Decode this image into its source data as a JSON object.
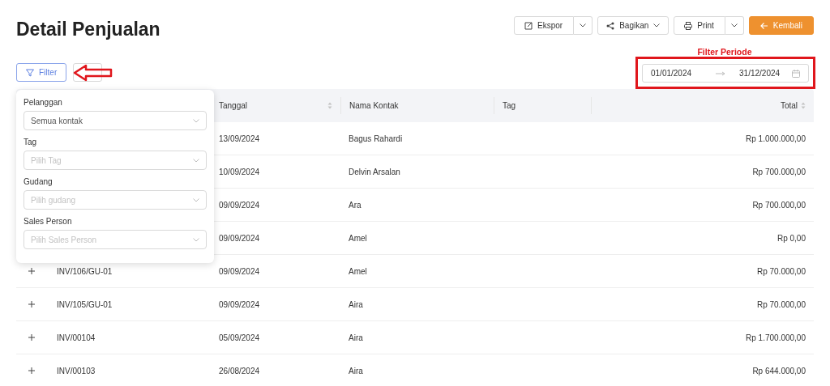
{
  "title": "Detail Penjualan",
  "toolbar": [
    {
      "kind": "split",
      "label": "Ekspor"
    },
    {
      "kind": "menu",
      "label": "Bagikan"
    },
    {
      "kind": "split",
      "label": "Print"
    },
    {
      "kind": "primary",
      "label": "Kembali"
    }
  ],
  "filter_button": {
    "label": "Filter"
  },
  "annotations": {
    "period_label": "Filter Periode"
  },
  "date_range": {
    "start": "01/01/2024",
    "end": "31/12/2024"
  },
  "filter_panel": [
    {
      "label": "Pelanggan",
      "value": "Semua kontak"
    },
    {
      "label": "Tag",
      "placeholder": "Pilih Tag"
    },
    {
      "label": "Gudang",
      "placeholder": "Pilih gudang"
    },
    {
      "label": "Sales Person",
      "placeholder": "Pilih Sales Person"
    }
  ],
  "table": {
    "columns": [
      {
        "label": "Tanggal",
        "sortable": true
      },
      {
        "label": "Nama Kontak",
        "sortable": false
      },
      {
        "label": "Tag",
        "sortable": false
      },
      {
        "label": "Total",
        "sortable": true
      }
    ],
    "rows": [
      {
        "tanggal": "13/09/2024",
        "kontak": "Bagus Rahardi",
        "total": "Rp 1.000.000,00"
      },
      {
        "tanggal": "10/09/2024",
        "kontak": "Delvin Arsalan",
        "total": "Rp 700.000,00"
      },
      {
        "tanggal": "09/09/2024",
        "kontak": "Ara",
        "total": "Rp 700.000,00"
      },
      {
        "tanggal": "09/09/2024",
        "kontak": "Amel",
        "total": "Rp 0,00"
      },
      {
        "nomor": "INV/106/GU-01",
        "tanggal": "09/09/2024",
        "kontak": "Amel",
        "total": "Rp 70.000,00"
      },
      {
        "nomor": "INV/105/GU-01",
        "tanggal": "09/09/2024",
        "kontak": "Aira",
        "total": "Rp 70.000,00"
      },
      {
        "nomor": "INV/00104",
        "tanggal": "05/09/2024",
        "kontak": "Aira",
        "total": "Rp 1.700.000,00"
      },
      {
        "nomor": "INV/00103",
        "tanggal": "26/08/2024",
        "kontak": "Aira",
        "total": "Rp 644.000,00"
      }
    ]
  }
}
